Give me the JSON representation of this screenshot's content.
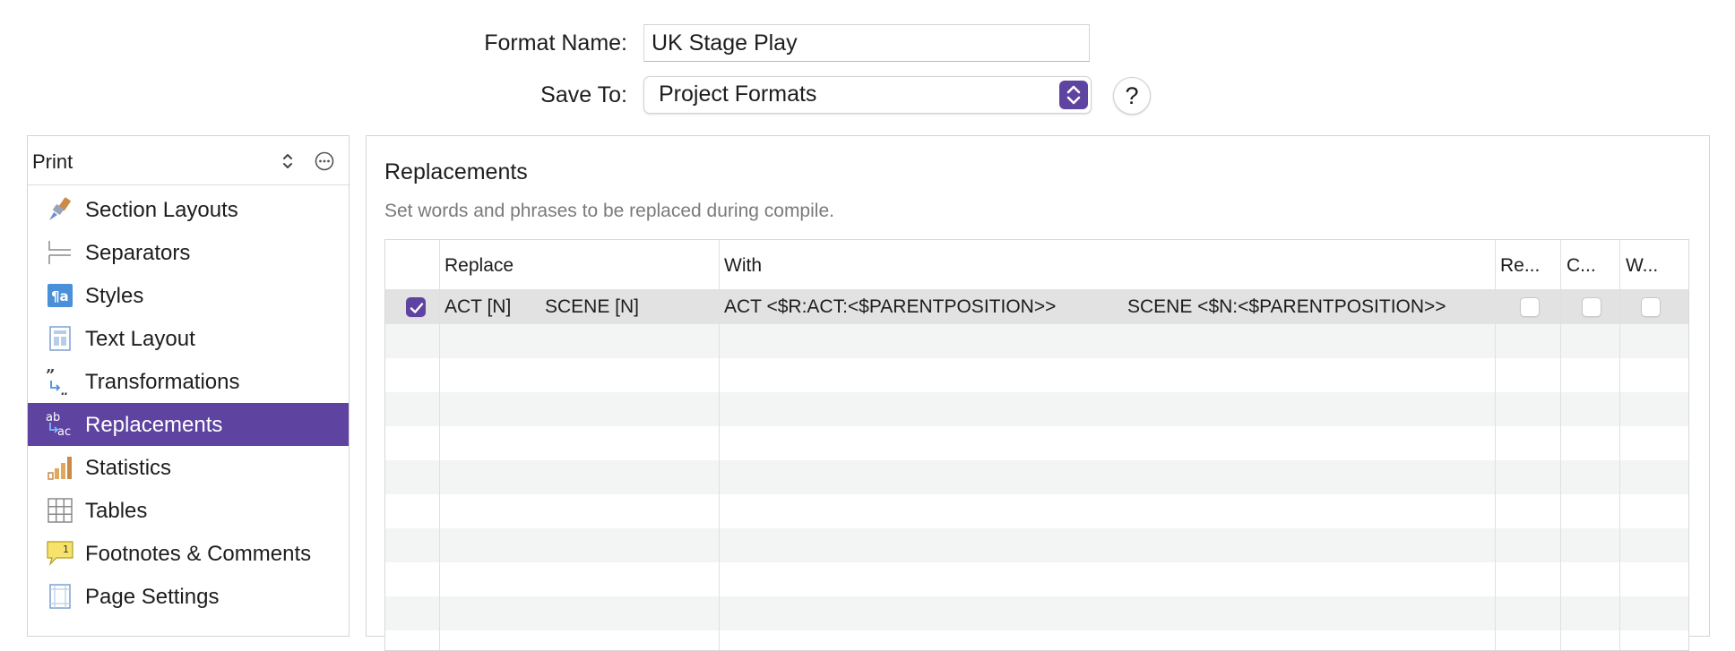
{
  "header": {
    "format_name_label": "Format Name:",
    "format_name_value": "UK Stage Play",
    "save_to_label": "Save To:",
    "save_to_value": "Project Formats",
    "help_label": "?"
  },
  "sidebar": {
    "mode": "Print",
    "items": [
      {
        "label": "Section Layouts",
        "icon": "brush-icon"
      },
      {
        "label": "Separators",
        "icon": "separators-icon"
      },
      {
        "label": "Styles",
        "icon": "styles-icon"
      },
      {
        "label": "Text Layout",
        "icon": "text-layout-icon"
      },
      {
        "label": "Transformations",
        "icon": "transformations-icon"
      },
      {
        "label": "Replacements",
        "icon": "replacements-icon",
        "selected": true
      },
      {
        "label": "Statistics",
        "icon": "statistics-icon"
      },
      {
        "label": "Tables",
        "icon": "tables-icon"
      },
      {
        "label": "Footnotes & Comments",
        "icon": "footnotes-icon"
      },
      {
        "label": "Page Settings",
        "icon": "page-settings-icon"
      }
    ]
  },
  "main": {
    "title": "Replacements",
    "description": "Set words and phrases to be replaced during compile.",
    "columns": [
      "Replace",
      "With",
      "Re...",
      "C...",
      "W..."
    ],
    "rows": [
      {
        "enabled": true,
        "replace_1": "ACT [N]",
        "replace_2": "SCENE [N]",
        "with_1": "ACT <$R:ACT:<$PARENTPOSITION>>",
        "with_2": "SCENE <$N:<$PARENTPOSITION>>",
        "regex": false,
        "case": false,
        "whole_word": false
      }
    ]
  },
  "colors": {
    "accent": "#5e44a0"
  }
}
